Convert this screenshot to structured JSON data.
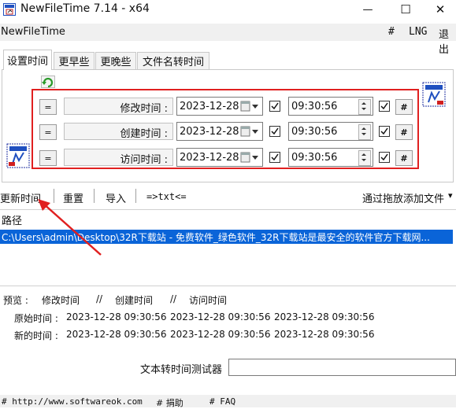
{
  "window": {
    "title": "NewFileTime 7.14 - x64",
    "minimize_glyph": "—",
    "maximize_glyph": "☐",
    "close_glyph": "✕"
  },
  "menubar": {
    "app_name": "NewFileTime",
    "hash": "#",
    "lng": "LNG",
    "exit": "退出"
  },
  "tabs": [
    {
      "label": "设置时间",
      "active": true
    },
    {
      "label": "更早些",
      "active": false
    },
    {
      "label": "更晚些",
      "active": false
    },
    {
      "label": "文件名转时间",
      "active": false
    }
  ],
  "time_rows": [
    {
      "eq": "=",
      "label": "修改时间 :",
      "date": "2023-12-28",
      "time": "09:30:56",
      "hash": "#",
      "checked": true,
      "time_checked": true
    },
    {
      "eq": "=",
      "label": "创建时间 :",
      "date": "2023-12-28",
      "time": "09:30:56",
      "hash": "#",
      "checked": true,
      "time_checked": true
    },
    {
      "eq": "=",
      "label": "访问时间 :",
      "date": "2023-12-28",
      "time": "09:30:56",
      "hash": "#",
      "checked": true,
      "time_checked": true
    }
  ],
  "toolbar": {
    "update": "更新时间",
    "reset": "重置",
    "import": "导入",
    "txt": "=>txt<=",
    "drag_add": "通过拖放添加文件",
    "drag_arrow": "▾"
  },
  "list": {
    "header": "路径",
    "rows": [
      "C:\\Users\\admin\\Desktop\\32R下载站 - 免费软件_绿色软件_32R下载站是最安全的软件官方下载网..."
    ]
  },
  "preview": {
    "label": "预览 :",
    "mod": "修改时间",
    "sep1": "//",
    "create": "创建时间",
    "sep2": "//",
    "access": "访问时间",
    "orig_label": "原始时间 :",
    "orig_values": [
      "2023-12-28 09:30:56",
      "2023-12-28 09:30:56",
      "2023-12-28 09:30:56"
    ],
    "new_label": "新的时间 :",
    "new_values": [
      "2023-12-28 09:30:56",
      "2023-12-28 09:30:56",
      "2023-12-28 09:30:56"
    ]
  },
  "tester": {
    "label": "文本转时间测试器",
    "value": ""
  },
  "status": {
    "url": "# http://www.softwareok.com",
    "donate": "# 捐助",
    "faq": "# FAQ"
  },
  "colors": {
    "highlight": "#e02020",
    "selection": "#0a64d8"
  }
}
